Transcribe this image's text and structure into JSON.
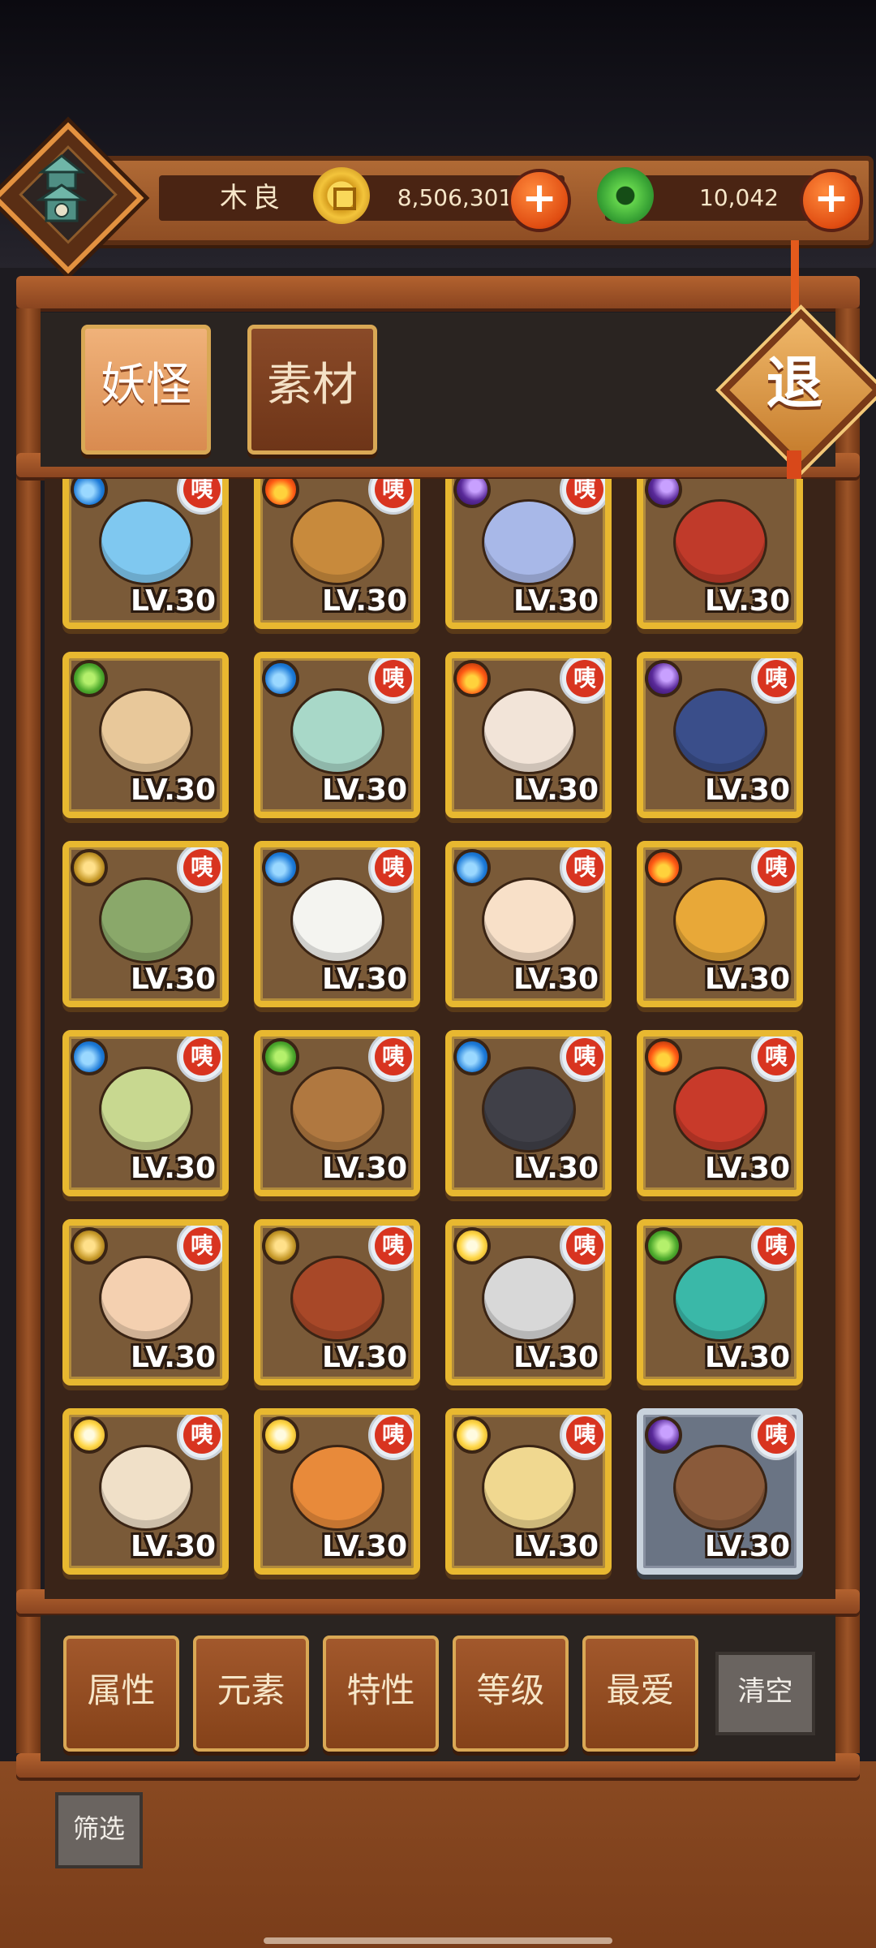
{
  "player": {
    "name": "木良"
  },
  "resources": {
    "gold": "8,506,301",
    "jade": "10,042"
  },
  "tabs": [
    {
      "label": "妖怪"
    },
    {
      "label": "素材"
    }
  ],
  "exit": {
    "label": "退"
  },
  "cards": [
    {
      "element": "water",
      "level": "LV.30",
      "badge": "咦",
      "creature": "blue-slime",
      "frame": "gold"
    },
    {
      "element": "fire",
      "level": "LV.30",
      "badge": "咦",
      "creature": "hook-lantern",
      "frame": "gold"
    },
    {
      "element": "dark",
      "level": "LV.30",
      "badge": "咦",
      "creature": "rice-ball-spirit",
      "frame": "gold"
    },
    {
      "element": "dark",
      "level": "LV.30",
      "badge": "",
      "creature": "masked-warlord",
      "frame": "gold"
    },
    {
      "element": "wood",
      "level": "LV.30",
      "badge": "",
      "creature": "log-sprite",
      "frame": "gold"
    },
    {
      "element": "water",
      "level": "LV.30",
      "badge": "咦",
      "creature": "vase-sprite",
      "frame": "gold"
    },
    {
      "element": "fire",
      "level": "LV.30",
      "badge": "咦",
      "creature": "patched-cat",
      "frame": "gold"
    },
    {
      "element": "dark",
      "level": "LV.30",
      "badge": "咦",
      "creature": "spear-boy",
      "frame": "gold"
    },
    {
      "element": "earth",
      "level": "LV.30",
      "badge": "咦",
      "creature": "pipe-sprite",
      "frame": "gold"
    },
    {
      "element": "water",
      "level": "LV.30",
      "badge": "咦",
      "creature": "white-flower",
      "frame": "gold"
    },
    {
      "element": "water",
      "level": "LV.30",
      "badge": "咦",
      "creature": "lotus-sprite",
      "frame": "gold"
    },
    {
      "element": "fire",
      "level": "LV.30",
      "badge": "咦",
      "creature": "yellow-leaf",
      "frame": "gold"
    },
    {
      "element": "water",
      "level": "LV.30",
      "badge": "咦",
      "creature": "bamboo-flute",
      "frame": "gold"
    },
    {
      "element": "wood",
      "level": "LV.30",
      "badge": "咦",
      "creature": "gourd-spirit",
      "frame": "gold"
    },
    {
      "element": "water",
      "level": "LV.30",
      "badge": "咦",
      "creature": "sword-penguin",
      "frame": "gold"
    },
    {
      "element": "fire",
      "level": "LV.30",
      "badge": "咦",
      "creature": "red-ribbon",
      "frame": "gold"
    },
    {
      "element": "earth",
      "level": "LV.30",
      "badge": "咦",
      "creature": "fan-lady",
      "frame": "gold"
    },
    {
      "element": "earth",
      "level": "LV.30",
      "badge": "咦",
      "creature": "bowl-sprite",
      "frame": "gold"
    },
    {
      "element": "light",
      "level": "LV.30",
      "badge": "咦",
      "creature": "broad-sword",
      "frame": "gold"
    },
    {
      "element": "wood",
      "level": "LV.30",
      "badge": "咦",
      "creature": "jade-lion",
      "frame": "gold"
    },
    {
      "element": "light",
      "level": "LV.30",
      "badge": "咦",
      "creature": "feather-lady",
      "frame": "gold"
    },
    {
      "element": "light",
      "level": "LV.30",
      "badge": "咦",
      "creature": "peach-fox",
      "frame": "gold"
    },
    {
      "element": "light",
      "level": "LV.30",
      "badge": "咦",
      "creature": "monk-chick",
      "frame": "gold"
    },
    {
      "element": "dark",
      "level": "LV.30",
      "badge": "咦",
      "creature": "monkey-stone",
      "frame": "silver"
    }
  ],
  "filters": [
    {
      "label": "属性"
    },
    {
      "label": "元素"
    },
    {
      "label": "特性"
    },
    {
      "label": "等级"
    },
    {
      "label": "最爱"
    }
  ],
  "clear": {
    "label": "清空"
  },
  "screen": {
    "label": "筛选"
  },
  "colors": {
    "card_gold": "#e8b830",
    "card_silver": "#c8d2dc",
    "wood": "#8a4520",
    "badge_red": "#d83420"
  }
}
